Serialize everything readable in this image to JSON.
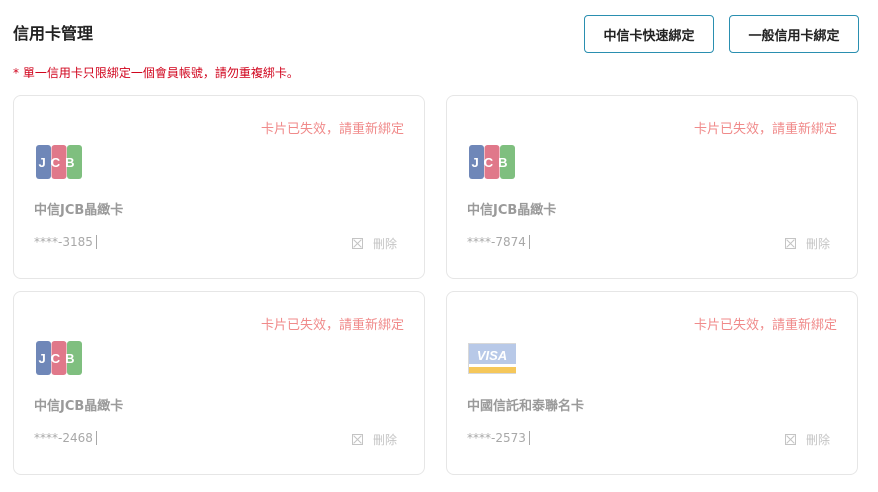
{
  "page": {
    "title": "信用卡管理",
    "notice": "* 單一信用卡只限綁定一個會員帳號，請勿重複綁卡。"
  },
  "buttons": {
    "fast_bind": "中信卡快速綁定",
    "general_bind": "一般信用卡綁定"
  },
  "cards": [
    {
      "status": "卡片已失效，請重新綁定",
      "brand": "JCB",
      "name": "中信JCB晶緻卡",
      "number": "****-3185",
      "delete": "刪除"
    },
    {
      "status": "卡片已失效，請重新綁定",
      "brand": "JCB",
      "name": "中信JCB晶緻卡",
      "number": "****-7874",
      "delete": "刪除"
    },
    {
      "status": "卡片已失效，請重新綁定",
      "brand": "JCB",
      "name": "中信JCB晶緻卡",
      "number": "****-2468",
      "delete": "刪除"
    },
    {
      "status": "卡片已失效，請重新綁定",
      "brand": "VISA",
      "name": "中國信託和泰聯名卡",
      "number": "****-2573",
      "delete": "刪除"
    }
  ],
  "icons": {
    "jcb": "jcb-logo-icon",
    "visa": "visa-logo-icon",
    "delete": "delete-icon"
  },
  "colors": {
    "accent": "#2a8fb0",
    "notice": "#d0021b",
    "status": "#f08a8a"
  }
}
